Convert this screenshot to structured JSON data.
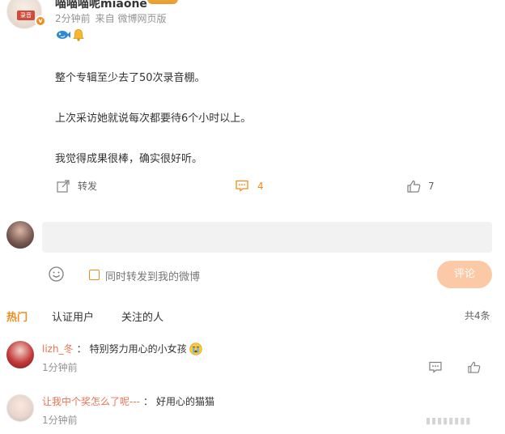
{
  "post": {
    "username": "喵喵喵呢miaone",
    "avatar_badge": "录音",
    "time": "2分钟前",
    "source": "来自 微博网页版",
    "emojis": [
      "fish-icon",
      "bell-icon"
    ],
    "lines": [
      "整个专辑至少去了50次录音棚。",
      "上次采访她就说每次都要待6个小时以上。",
      "我觉得成果很棒，确实很好听。"
    ]
  },
  "actions": {
    "forward_label": "转发",
    "comment_count": "4",
    "like_count": "7"
  },
  "composer": {
    "placeholder": "",
    "also_forward_label": "同时转发到我的微博",
    "submit_label": "评论"
  },
  "tabs": {
    "hot": "热门",
    "verified": "认证用户",
    "following": "关注的人",
    "total": "共4条"
  },
  "comments": [
    {
      "user": "lizh_冬",
      "separator": "：",
      "text": "特别努力用心的小女孩",
      "time": "1分钟前",
      "emoji": "crying-face-icon"
    },
    {
      "user": "让我中个奖怎么了呢---",
      "separator": "：",
      "text": "好用心的猫猫",
      "time": "1分钟前"
    }
  ],
  "colors": {
    "accent": "#f08c1f",
    "username_link": "#eb7350",
    "submit_disabled": "#fbc9a6",
    "composer_bg": "#f2f2f2"
  }
}
